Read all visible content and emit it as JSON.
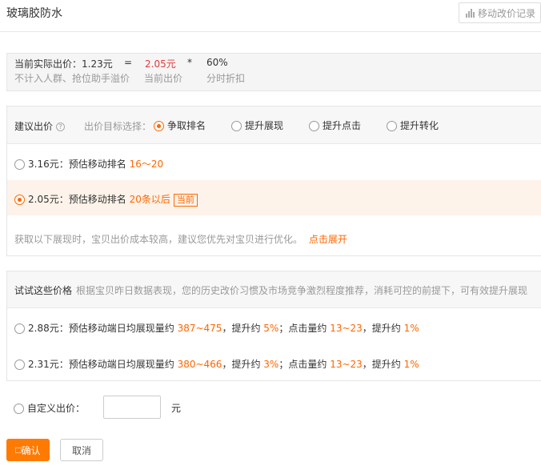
{
  "header": {
    "title": "玻璃胶防水",
    "history_button": "移动改价记录"
  },
  "price_summary": {
    "actual_label": "当前实际出价：1.23元",
    "eq": "=",
    "bid_value": "2.05元",
    "mul": "*",
    "discount": "60%",
    "actual_note": "不计入人群、抢位助手溢价",
    "bid_note": "当前出价",
    "discount_note": "分时折扣"
  },
  "suggest": {
    "label": "建议出价",
    "help_icon": "question-circle-icon",
    "target_label": "出价目标选择：",
    "targets": [
      {
        "label": "争取排名",
        "selected": true
      },
      {
        "label": "提升展现",
        "selected": false
      },
      {
        "label": "提升点击",
        "selected": false
      },
      {
        "label": "提升转化",
        "selected": false
      }
    ],
    "options": [
      {
        "price": "3.16元：",
        "desc": "预估移动排名",
        "rank": "16～20",
        "tag": "",
        "selected": false
      },
      {
        "price": "2.05元：",
        "desc": "预估移动排名",
        "rank": "20条以后",
        "tag": "当前",
        "selected": true
      }
    ],
    "hint": "获取以下展现时，宝贝出价成本较高，建议您优先对宝贝进行优化。",
    "expand_link": "点击展开"
  },
  "try_prices": {
    "label": "试试这些价格",
    "desc": "根据宝贝昨日数据表现，您的历史改价习惯及市场竞争激烈程度推荐，消耗可控的前提下，可有效提升展现",
    "options": [
      {
        "price": "2.88元：",
        "imp_label": "预估移动端日均展现量约",
        "imp": "387~475",
        "up1_label": "，提升约",
        "up1": "5%",
        "click_label": "；点击量约",
        "click": "13~23",
        "up2_label": "，提升约",
        "up2": "1%"
      },
      {
        "price": "2.31元：",
        "imp_label": "预估移动端日均展现量约",
        "imp": "380~466",
        "up1_label": "，提升约",
        "up1": "3%",
        "click_label": "；点击量约",
        "click": "13~23",
        "up2_label": "，提升约",
        "up2": "1%"
      }
    ]
  },
  "custom": {
    "label": "自定义出价：",
    "value": "",
    "unit": "元"
  },
  "actions": {
    "confirm": "确认",
    "cancel": "取消"
  },
  "colors": {
    "accent": "#ff6600",
    "button": "#ff7a00",
    "red": "#e4393c"
  }
}
